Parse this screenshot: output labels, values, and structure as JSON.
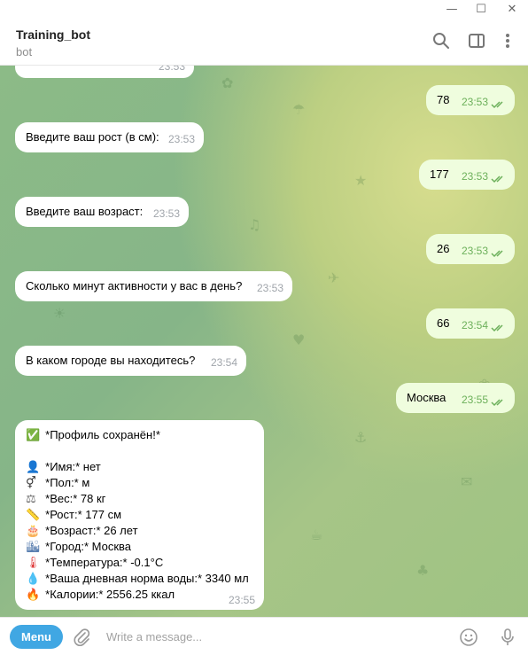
{
  "window": {
    "minimize_glyph": "—",
    "maximize_glyph": "☐",
    "close_glyph": "✕"
  },
  "header": {
    "title": "Training_bot",
    "subtitle": "bot",
    "icons": [
      "search-icon",
      "sidebar-toggle-icon",
      "more-vertical-icon"
    ]
  },
  "messages": [
    {
      "dir": "in",
      "text": "",
      "time": "23:53"
    },
    {
      "dir": "out",
      "text": "78",
      "time": "23:53"
    },
    {
      "dir": "in",
      "text": "Введите ваш рост (в см):",
      "time": "23:53"
    },
    {
      "dir": "out",
      "text": "177",
      "time": "23:53"
    },
    {
      "dir": "in",
      "text": "Введите ваш возраст:",
      "time": "23:53"
    },
    {
      "dir": "out",
      "text": "26",
      "time": "23:53"
    },
    {
      "dir": "in",
      "text": "Сколько минут активности у вас в день?",
      "time": "23:53"
    },
    {
      "dir": "out",
      "text": "66",
      "time": "23:54"
    },
    {
      "dir": "in",
      "text": "В каком городе вы находитесь?",
      "time": "23:54"
    },
    {
      "dir": "out",
      "text": "Москва",
      "time": "23:55"
    }
  ],
  "profile_card": {
    "time": "23:55",
    "lines": [
      {
        "emoji": "✅",
        "text": "*Профиль сохранён!*"
      },
      {
        "emoji": "👤",
        "text": "*Имя:* нет"
      },
      {
        "emoji": "⚥",
        "text": "*Пол:* м"
      },
      {
        "emoji": "⚖",
        "text": "*Вес:* 78 кг"
      },
      {
        "emoji": "📏",
        "text": "*Рост:* 177 см"
      },
      {
        "emoji": "🎂",
        "text": "*Возраст:* 26 лет"
      },
      {
        "emoji": "🏙",
        "text": "*Город:* Москва"
      },
      {
        "emoji": "🌡",
        "text": "*Температура:* -0.1°C"
      },
      {
        "emoji": "💧",
        "text": "*Ваша дневная норма воды:* 3340 мл"
      },
      {
        "emoji": "🔥",
        "text": "*Калории:* 2556.25 ккал"
      }
    ]
  },
  "composer": {
    "menu_label": "Menu",
    "placeholder": "Write a message...",
    "icons": [
      "attach-icon",
      "emoji-icon",
      "microphone-icon"
    ]
  },
  "colors": {
    "accent": "#40a7e3",
    "incoming_bubble": "#ffffff",
    "outgoing_bubble": "#effdde",
    "read_ticks": "#6cb05a"
  }
}
